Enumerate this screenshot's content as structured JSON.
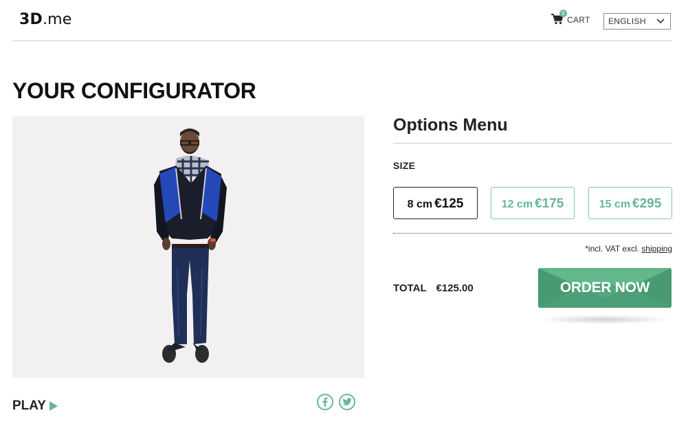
{
  "header": {
    "logo_bold": "3D",
    "logo_rest": ".me",
    "cart_count": "0",
    "cart_label": "CART",
    "language": "ENGLISH"
  },
  "page": {
    "title": "YOUR CONFIGURATOR"
  },
  "viewer": {
    "play_label": "PLAY"
  },
  "social": [
    {
      "icon": "facebook-icon"
    },
    {
      "icon": "twitter-icon"
    }
  ],
  "options": {
    "title": "Options Menu",
    "size_label": "SIZE",
    "sizes": [
      {
        "size": "8 cm",
        "price": "€125",
        "selected": true
      },
      {
        "size": "12 cm",
        "price": "€175",
        "selected": false
      },
      {
        "size": "15 cm",
        "price": "€295",
        "selected": false
      }
    ],
    "vat_note": "*incl. VAT excl.",
    "shipping_link": "shipping",
    "total_label": "TOTAL",
    "total_value": "€125.00",
    "order_label": "ORDER NOW"
  },
  "colors": {
    "accent": "#67b795",
    "order_button": "#4fa37a",
    "viewer_bg": "#f2f0f0"
  }
}
